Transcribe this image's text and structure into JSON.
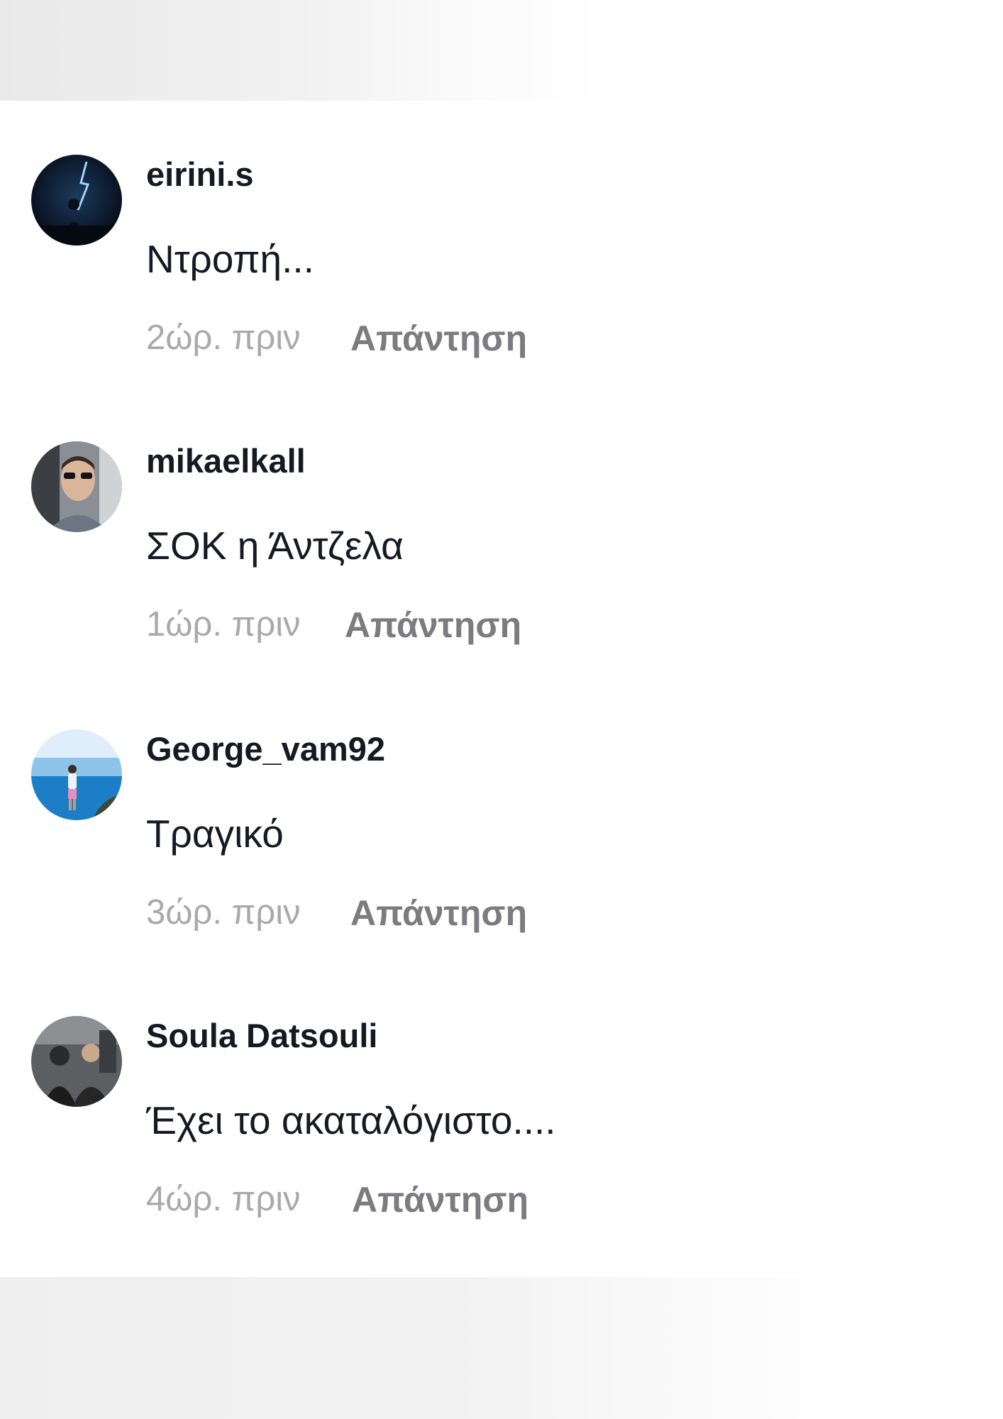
{
  "comments": [
    {
      "username": "eirini.s",
      "text": "Ντροπή...",
      "time": "2ώρ. πριν",
      "reply_label": "Απάντηση",
      "avatar_icon": "night-lightning-figure-avatar"
    },
    {
      "username": "mikaelkall",
      "text": "ΣΟΚ η Άντζελα",
      "time": "1ώρ. πριν",
      "reply_label": "Απάντηση",
      "avatar_icon": "man-sunglasses-car-avatar"
    },
    {
      "username": "George_vam92",
      "text": "Τραγικό",
      "time": "3ώρ. πριν",
      "reply_label": "Απάντηση",
      "avatar_icon": "person-by-sea-avatar"
    },
    {
      "username": "Soula Datsouli",
      "text": "Έχει το ακαταλόγιστο....",
      "time": "4ώρ. πριν",
      "reply_label": "Απάντηση",
      "avatar_icon": "dark-group-photo-avatar"
    }
  ],
  "colors": {
    "username": "#161823",
    "text": "#161823",
    "time": "#a9a9ad",
    "reply": "#7b7b80",
    "background": "#ffffff"
  }
}
